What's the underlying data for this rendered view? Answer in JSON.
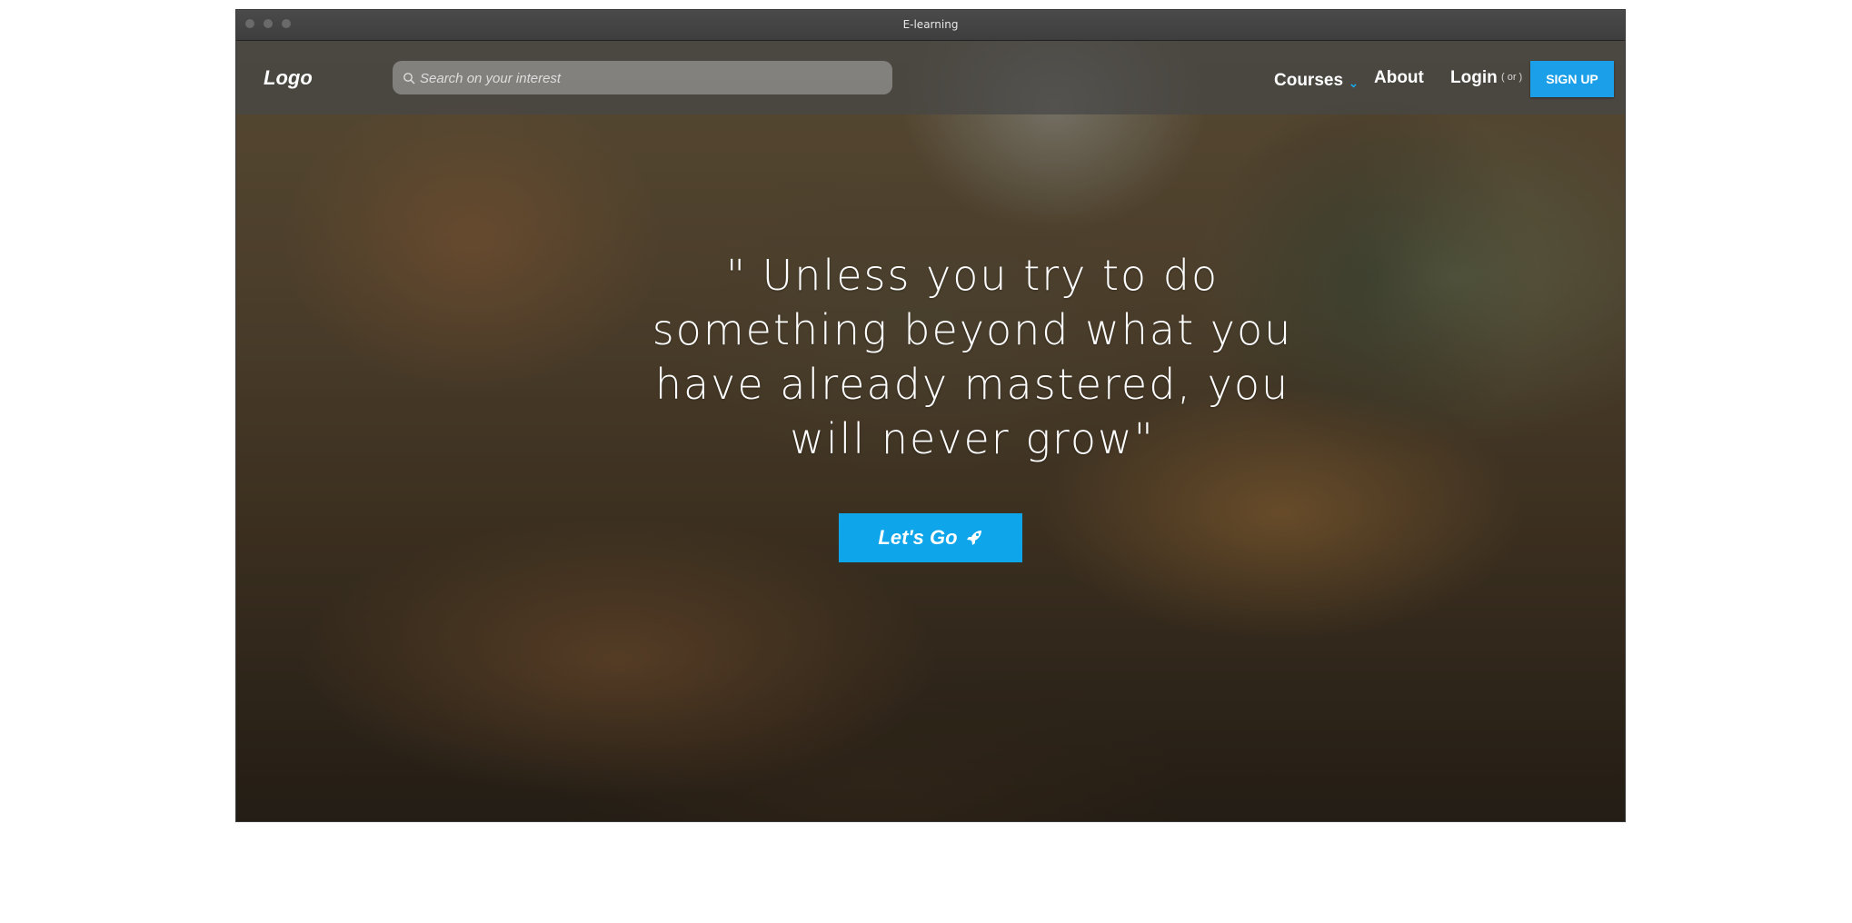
{
  "window": {
    "title": "E-learning"
  },
  "header": {
    "logo": "Logo",
    "search": {
      "placeholder": "Search on your interest",
      "value": ""
    },
    "nav": {
      "courses_label": "Courses",
      "about_label": "About",
      "login_label": "Login",
      "or_label": "( or )",
      "signup_label": "SIGN UP"
    }
  },
  "hero": {
    "quote": "\" Unless you try to do something beyond what you have already mastered, you will never grow\"",
    "cta_label": "Let's Go"
  },
  "icons": {
    "search": "search-icon",
    "courses_dropdown": "chevron-down-icon",
    "cta": "rocket-icon"
  },
  "colors": {
    "accent": "#1a9fe8",
    "cta_background": "#0ea5ea",
    "navbar_background": "#464646"
  }
}
